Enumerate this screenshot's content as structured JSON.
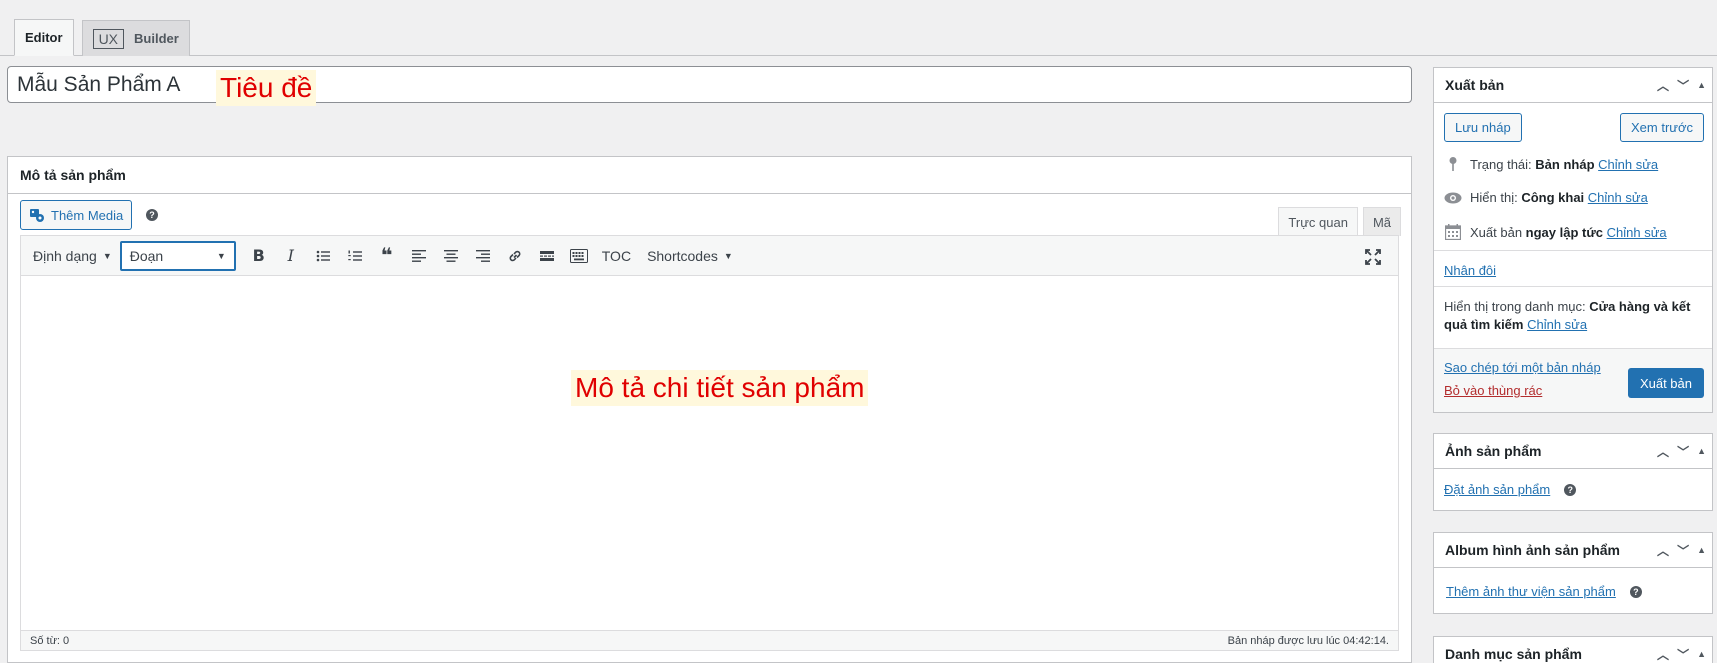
{
  "tabs": {
    "editor": "Editor",
    "ux_badge": "UX",
    "builder": "Builder"
  },
  "title": {
    "value": "Mẫu Sản Phẩm A",
    "annotation": "Tiêu đề"
  },
  "description_box": {
    "heading": "Mô tả sản phẩm",
    "add_media": "Thêm Media",
    "help": "?",
    "mode_visual": "Trực quan",
    "mode_code": "Mã",
    "toolbar": {
      "format_dropdown": "Định dạng",
      "paragraph_select": "Đoạn",
      "bold": "B",
      "italic": "I",
      "toc": "TOC",
      "shortcodes": "Shortcodes"
    },
    "body_annotation": "Mô tả chi tiết sản phẩm",
    "word_count": "Số từ: 0",
    "autosave": "Bản nháp được lưu lúc 04:42:14."
  },
  "publish_box": {
    "heading": "Xuất bản",
    "save_draft": "Lưu nháp",
    "preview": "Xem trước",
    "status_label": "Trạng thái:",
    "status_value": "Bản nháp",
    "visibility_label": "Hiển thị:",
    "visibility_value": "Công khai",
    "schedule_label": "Xuất bản",
    "schedule_value": "ngay lập tức",
    "edit": "Chỉnh sửa",
    "duplicate": "Nhân đôi",
    "catalog_label": "Hiển thị trong danh mục:",
    "catalog_value_1": "Cửa hàng và kết",
    "catalog_value_2": "quả tìm kiếm",
    "copy_draft": "Sao chép tới một bản nháp",
    "trash": "Bỏ vào thùng rác",
    "publish": "Xuất bản"
  },
  "product_image_box": {
    "heading": "Ảnh sản phẩm",
    "set_image": "Đặt ảnh sản phẩm"
  },
  "gallery_box": {
    "heading": "Album hình ảnh sản phẩm",
    "add_gallery": "Thêm ảnh thư viện sản phẩm"
  },
  "category_box": {
    "heading": "Danh mục sản phẩm"
  },
  "colors": {
    "accent": "#2271b1",
    "annotation_text": "#e00000",
    "annotation_bg": "#fff8dc",
    "trash": "#b32d2e"
  }
}
